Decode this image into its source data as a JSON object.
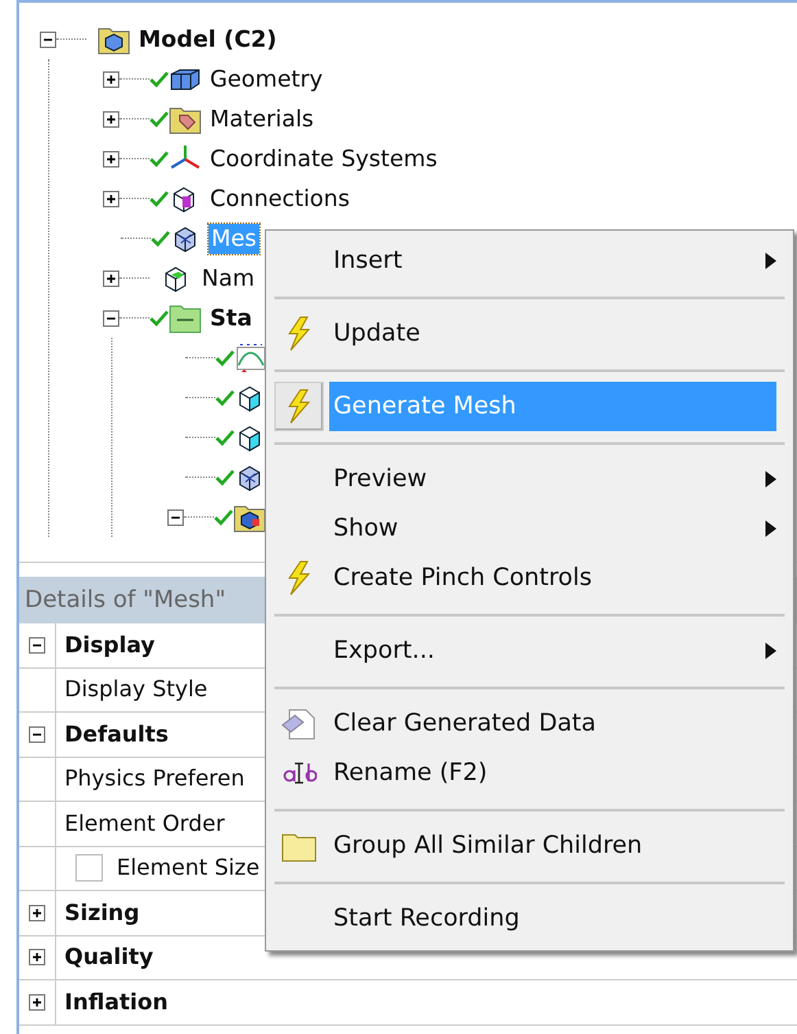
{
  "tree": {
    "label": "Model (C2)",
    "kind": "model",
    "expanded": true,
    "children": [
      {
        "label": "Geometry",
        "kind": "geometry",
        "expanded": false,
        "checked": true,
        "selected": false
      },
      {
        "label": "Materials",
        "kind": "materials",
        "expanded": false,
        "checked": true,
        "selected": false
      },
      {
        "label": "Coordinate Systems",
        "kind": "axes",
        "expanded": false,
        "checked": true,
        "selected": false
      },
      {
        "label": "Connections",
        "kind": "connections",
        "expanded": false,
        "checked": true,
        "selected": false
      },
      {
        "label": "Mes",
        "kind": "mesh",
        "checked": true,
        "selected": true
      },
      {
        "label": "Nam",
        "kind": "named",
        "expanded": false,
        "checked": false,
        "selected": false
      },
      {
        "label": "Sta",
        "kind": "analysis",
        "expanded": true,
        "checked": true,
        "selected": false,
        "children": [
          {
            "kind": "chart",
            "checked": true
          },
          {
            "kind": "support",
            "checked": true
          },
          {
            "kind": "support",
            "checked": true
          },
          {
            "kind": "mesh",
            "checked": true
          },
          {
            "kind": "solution",
            "expanded": true,
            "checked": true
          }
        ]
      }
    ]
  },
  "details": {
    "title": "Details of \"Mesh\"",
    "rows": [
      {
        "kind": "group",
        "label": "Display",
        "expanded": true
      },
      {
        "kind": "property",
        "label": "Display Style"
      },
      {
        "kind": "group",
        "label": "Defaults",
        "expanded": true
      },
      {
        "kind": "property",
        "label": "Physics Preferen"
      },
      {
        "kind": "property",
        "label": "Element Order"
      },
      {
        "kind": "check-property",
        "label": "Element Size",
        "checked": false
      },
      {
        "kind": "group",
        "label": "Sizing",
        "expanded": false
      },
      {
        "kind": "group",
        "label": "Quality",
        "expanded": false
      },
      {
        "kind": "group",
        "label": "Inflation",
        "expanded": false
      }
    ]
  },
  "context_menu": [
    {
      "kind": "submenu",
      "label": "Insert",
      "selected": false
    },
    {
      "kind": "separator"
    },
    {
      "kind": "lightning",
      "label": "Update",
      "selected": false
    },
    {
      "kind": "separator"
    },
    {
      "kind": "lightning",
      "label": "Generate Mesh",
      "selected": true
    },
    {
      "kind": "separator"
    },
    {
      "kind": "submenu",
      "label": "Preview",
      "selected": false
    },
    {
      "kind": "submenu",
      "label": "Show",
      "selected": false
    },
    {
      "kind": "lightning",
      "label": "Create Pinch Controls",
      "selected": false
    },
    {
      "kind": "separator"
    },
    {
      "kind": "submenu",
      "label": "Export...",
      "selected": false
    },
    {
      "kind": "separator"
    },
    {
      "kind": "eraser",
      "label": "Clear Generated Data",
      "selected": false
    },
    {
      "kind": "rename",
      "label": "Rename (F2)",
      "selected": false
    },
    {
      "kind": "separator"
    },
    {
      "kind": "folder",
      "label": "Group All Similar Children",
      "selected": false
    },
    {
      "kind": "separator"
    },
    {
      "kind": "plain",
      "label": "Start Recording",
      "selected": false
    }
  ]
}
